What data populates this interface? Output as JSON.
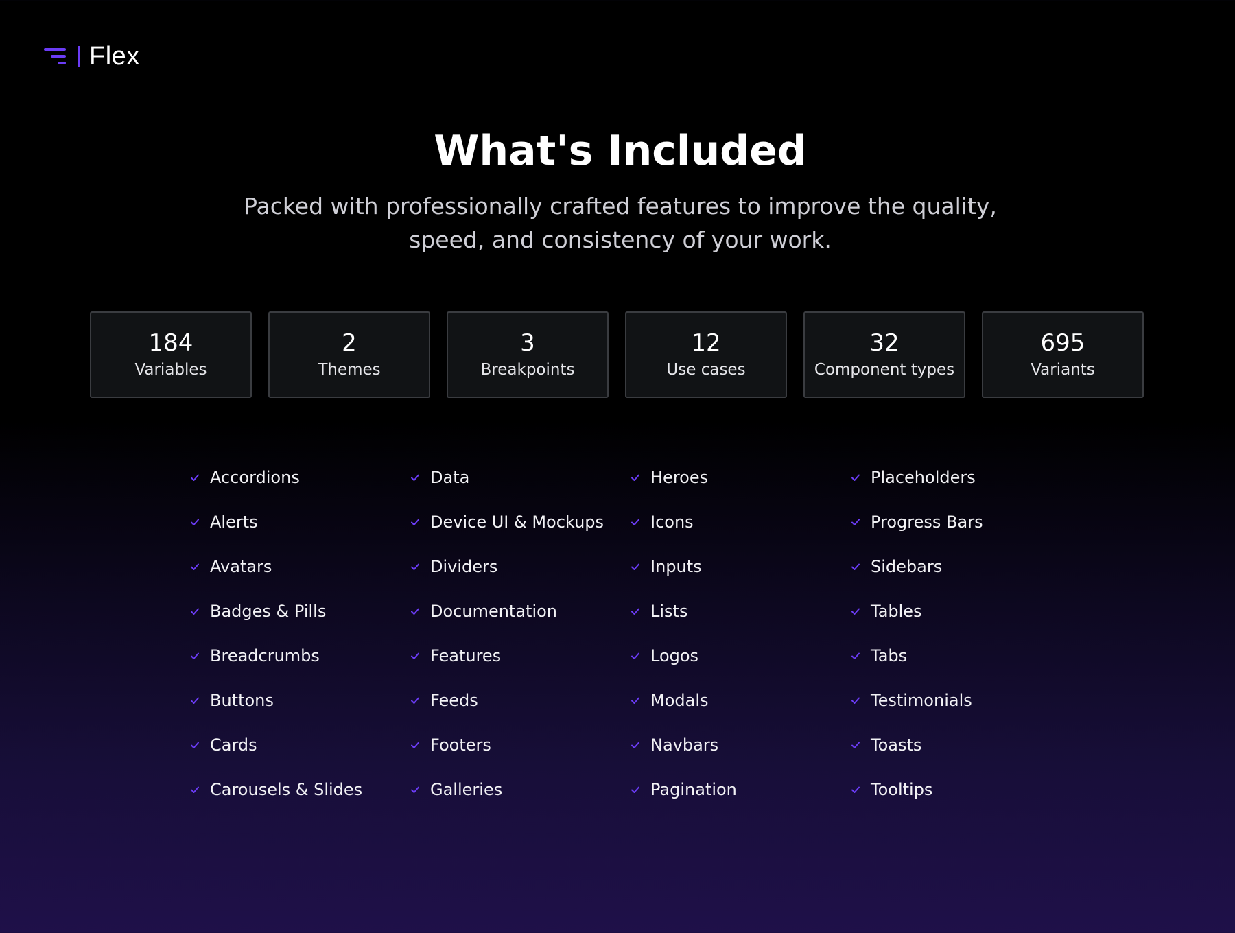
{
  "brand": {
    "name": "Flex",
    "accent_color": "#6b3cf5"
  },
  "hero": {
    "title": "What's Included",
    "subtitle": "Packed with professionally crafted features to improve the quality, speed, and consistency of your work."
  },
  "stats": [
    {
      "value": "184",
      "label": "Variables"
    },
    {
      "value": "2",
      "label": "Themes"
    },
    {
      "value": "3",
      "label": "Breakpoints"
    },
    {
      "value": "12",
      "label": "Use cases"
    },
    {
      "value": "32",
      "label": "Component types"
    },
    {
      "value": "695",
      "label": "Variants"
    }
  ],
  "features": {
    "icon": "check-icon",
    "columns": [
      [
        "Accordions",
        "Alerts",
        "Avatars",
        "Badges & Pills",
        "Breadcrumbs",
        "Buttons",
        "Cards",
        "Carousels & Slides"
      ],
      [
        "Data",
        "Device UI & Mockups",
        "Dividers",
        "Documentation",
        "Features",
        "Feeds",
        "Footers",
        "Galleries"
      ],
      [
        "Heroes",
        "Icons",
        "Inputs",
        "Lists",
        "Logos",
        "Modals",
        "Navbars",
        "Pagination"
      ],
      [
        "Placeholders",
        "Progress Bars",
        "Sidebars",
        "Tables",
        "Tabs",
        "Testimonials",
        "Toasts",
        "Tooltips"
      ]
    ]
  }
}
